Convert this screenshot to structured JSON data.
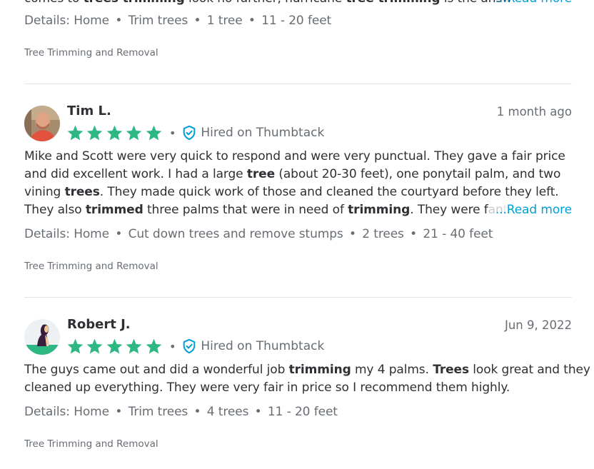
{
  "top": {
    "partial_line": [
      {
        "t": "comes to ",
        "b": false
      },
      {
        "t": "trees trimming",
        "b": true
      },
      {
        "t": " look no further, hurricane ",
        "b": false
      },
      {
        "t": "tree trimming",
        "b": true
      },
      {
        "t": " is the answ",
        "b": false
      }
    ],
    "read_more": "...Read more",
    "details": {
      "label": "Details:",
      "items": [
        "Home",
        "Trim trees",
        "1 tree",
        "11 - 20 feet"
      ]
    },
    "category": "Tree Trimming and Removal"
  },
  "reviews": [
    {
      "name": "Tim L.",
      "date": "1 month ago",
      "stars": 5,
      "hired_label": "Hired on Thumbtack",
      "lines": [
        [
          {
            "t": "Mike and Scott were very quick to respond and were very punctual. They gave a fair price",
            "b": false
          }
        ],
        [
          {
            "t": "and did excellent work. I had a large ",
            "b": false
          },
          {
            "t": "tree",
            "b": true
          },
          {
            "t": " (about 20-30 feet), one ponytail palm, and two",
            "b": false
          }
        ],
        [
          {
            "t": "vining ",
            "b": false
          },
          {
            "t": "trees",
            "b": true
          },
          {
            "t": ". They made quick work of those and cleaned the courtyard before they left.",
            "b": false
          }
        ],
        [
          {
            "t": "They also ",
            "b": false
          },
          {
            "t": "trimmed",
            "b": true
          },
          {
            "t": " three palms that were in need of ",
            "b": false
          },
          {
            "t": "trimming",
            "b": true
          },
          {
            "t": ". They were fant",
            "b": false
          }
        ]
      ],
      "read_more": "...Read more",
      "details": {
        "label": "Details:",
        "items": [
          "Home",
          "Cut down trees and remove stumps",
          "2 trees",
          "21 - 40 feet"
        ]
      },
      "category": "Tree Trimming and Removal"
    },
    {
      "name": "Robert J.",
      "date": "Jun 9, 2022",
      "stars": 5,
      "hired_label": "Hired on Thumbtack",
      "lines": [
        [
          {
            "t": "The guys came out and did a wonderful job ",
            "b": false
          },
          {
            "t": "trimming",
            "b": true
          },
          {
            "t": " my 4 palms. ",
            "b": false
          },
          {
            "t": "Trees",
            "b": true
          },
          {
            "t": " look great and they",
            "b": false
          }
        ],
        [
          {
            "t": "cleaned up everything. They were very fair in price so I recommend them highly.",
            "b": false
          }
        ]
      ],
      "read_more": "",
      "details": {
        "label": "Details:",
        "items": [
          "Home",
          "Trim trees",
          "4 trees",
          "11 - 20 feet"
        ]
      },
      "category": "Tree Trimming and Removal"
    }
  ],
  "colors": {
    "star": "#2db783",
    "verified": "#009fd9",
    "link": "#009fd9",
    "divider": "#e3e4e6"
  },
  "icons": {
    "star": "star-icon",
    "verified": "verified-shield-icon"
  }
}
